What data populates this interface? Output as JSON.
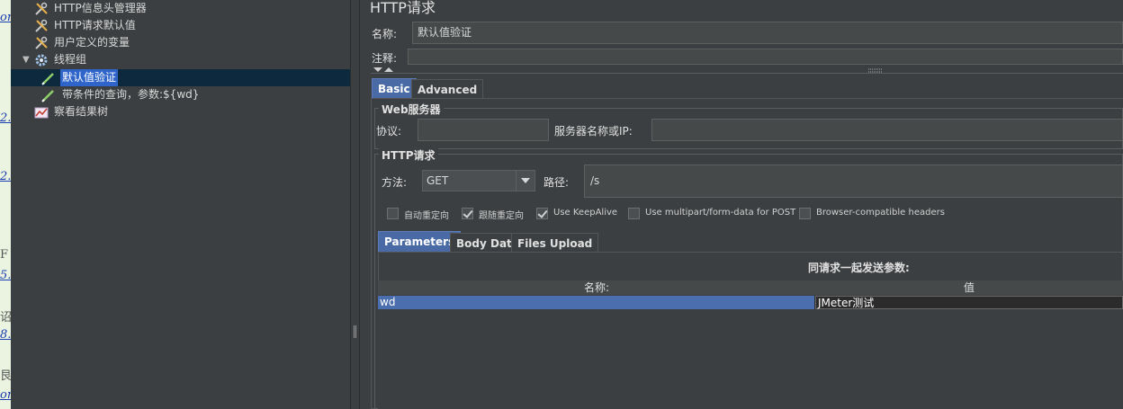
{
  "tree": {
    "items": [
      {
        "label": "HTTP信息头管理器",
        "icon": "wrench-icon"
      },
      {
        "label": "HTTP请求默认值",
        "icon": "wrench-icon"
      },
      {
        "label": "用户定义的变量",
        "icon": "wrench-icon"
      },
      {
        "label": "线程组",
        "icon": "gear-icon"
      },
      {
        "label": "默认值验证",
        "icon": "sampler-pen-icon"
      },
      {
        "label": "带条件的查询，参数:${wd}",
        "icon": "sampler-pen-icon"
      },
      {
        "label": "察看结果树",
        "icon": "chart-icon"
      }
    ],
    "selected_index": 4
  },
  "panel": {
    "title": "HTTP请求",
    "name_label": "名称:",
    "name_value": "默认值验证",
    "comment_label": "注释:",
    "comment_value": "",
    "tabs": [
      "Basic",
      "Advanced"
    ],
    "active_tab": "Basic",
    "web_server": {
      "legend": "Web服务器",
      "protocol_label": "协议:",
      "protocol_value": "",
      "server_label": "服务器名称或IP:",
      "server_value": ""
    },
    "http_request": {
      "legend": "HTTP请求",
      "method_label": "方法:",
      "method_value": "GET",
      "path_label": "路径:",
      "path_value": "/s"
    },
    "checkboxes": [
      {
        "label": "自动重定向",
        "checked": false
      },
      {
        "label": "跟随重定向",
        "checked": true
      },
      {
        "label": "Use KeepAlive",
        "checked": true
      },
      {
        "label": "Use multipart/form-data for POST",
        "checked": false
      },
      {
        "label": "Browser-compatible headers",
        "checked": false
      }
    ],
    "sub_tabs": [
      "Parameters",
      "Body Data",
      "Files Upload"
    ],
    "active_sub_tab": "Parameters",
    "params_title": "同请求一起发送参数:",
    "params_headers": [
      "名称:",
      "值"
    ],
    "params_rows": [
      {
        "name": "wd",
        "value": "JMeter测试"
      }
    ]
  },
  "background_doc": {
    "fragments": [
      "on",
      "2.",
      "2.",
      "F",
      "5.",
      "诏,",
      "8.",
      "艮",
      "on"
    ]
  },
  "colors": {
    "bg": "#3c3f41",
    "selection": "#2f65ca",
    "active_tab": "#4a6aa5"
  }
}
